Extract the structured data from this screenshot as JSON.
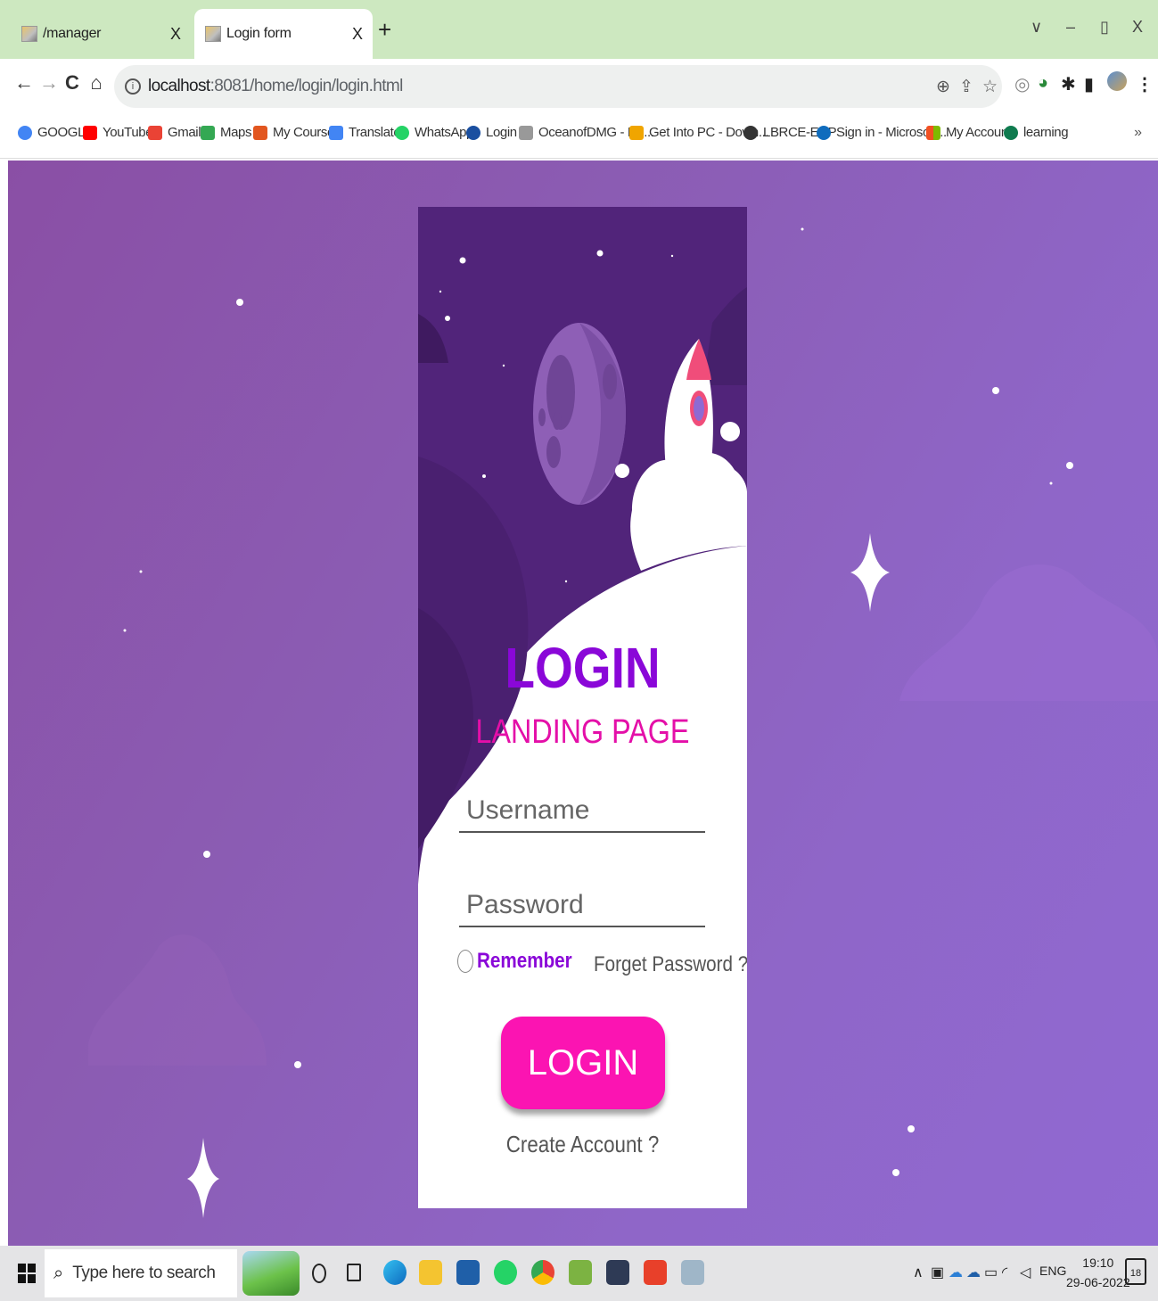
{
  "browser": {
    "tabs": [
      {
        "title": "/manager",
        "close": "X"
      },
      {
        "title": "Login form",
        "close": "X"
      }
    ],
    "new_tab": "+",
    "window_controls": {
      "chevron": "∨",
      "minimize": "–",
      "restore": "▯",
      "close": "X"
    },
    "nav": {
      "back": "←",
      "forward": "→",
      "reload": "C",
      "home": "⌂"
    },
    "url_host": "localhost",
    "url_path": ":8081/home/login/login.html",
    "bookmarks": [
      {
        "label": "GOOGLE",
        "color": "#4285f4"
      },
      {
        "label": "YouTube",
        "color": "#ff0000"
      },
      {
        "label": "Gmail",
        "color": "#ea4335"
      },
      {
        "label": "Maps",
        "color": "#34a853"
      },
      {
        "label": "My Courses",
        "color": "#e2561f"
      },
      {
        "label": "Translate",
        "color": "#4285f4"
      },
      {
        "label": "WhatsApp",
        "color": "#25d366"
      },
      {
        "label": "Login",
        "color": "#1a4fa0"
      },
      {
        "label": "OceanofDMG - Do...",
        "color": "#999999"
      },
      {
        "label": "Get Into PC - Down...",
        "color": "#f0a500"
      },
      {
        "label": "LBRCE-ERP",
        "color": "#333333"
      },
      {
        "label": "Sign in - Microsoft...",
        "color": "#0f6cbd"
      },
      {
        "label": "My Account",
        "color": "#f25022"
      },
      {
        "label": "learning",
        "color": "#0f7b4f"
      }
    ],
    "bookmarks_more": "»"
  },
  "login": {
    "title": "LOGIN",
    "subtitle": "LANDING PAGE",
    "username_placeholder": "Username",
    "password_placeholder": "Password",
    "remember": "Remember",
    "forget": "Forget Password ?",
    "button": "LOGIN",
    "create": "Create Account ?"
  },
  "taskbar": {
    "search_placeholder": "Type here to search",
    "lang": "ENG",
    "time": "19:10",
    "date": "29-06-2022",
    "notifications": "18"
  },
  "colors": {
    "accent_purple": "#8a07d8",
    "accent_pink": "#fb14b2",
    "subtitle_pink": "#e40fa8",
    "card_purple": "#51247a"
  }
}
